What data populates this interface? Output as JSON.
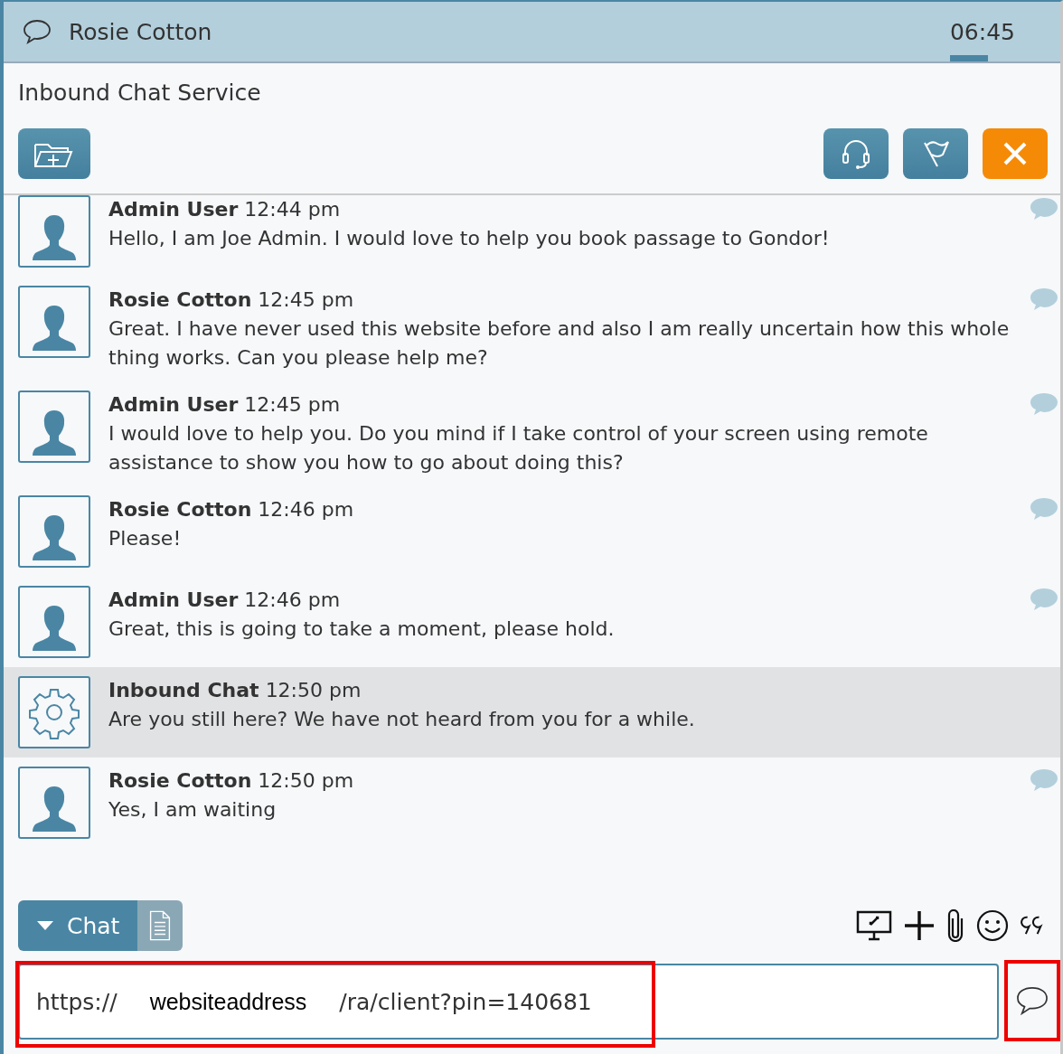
{
  "header": {
    "title": "Rosie Cotton",
    "timer": "06:45"
  },
  "service": "Inbound Chat Service",
  "messages": [
    {
      "kind": "user",
      "sender": "Admin User",
      "time": "12:44 pm",
      "text": "Hello, I am Joe Admin. I would love to help you book passage to Gondor!"
    },
    {
      "kind": "user",
      "sender": "Rosie Cotton",
      "time": "12:45 pm",
      "text": "Great. I have never used this website before and also I am really uncertain how this whole thing works. Can you please help me?"
    },
    {
      "kind": "user",
      "sender": "Admin User",
      "time": "12:45 pm",
      "text": "I would love to help you. Do you mind if I take control of your screen using remote assistance to show you how to go about doing this?"
    },
    {
      "kind": "user",
      "sender": "Rosie Cotton",
      "time": "12:46 pm",
      "text": "Please!"
    },
    {
      "kind": "user",
      "sender": "Admin User",
      "time": "12:46 pm",
      "text": "Great, this is going to take a moment, please hold."
    },
    {
      "kind": "system",
      "sender": "Inbound Chat",
      "time": "12:50 pm",
      "text": "Are you still here? We have not heard from you for a while."
    },
    {
      "kind": "user",
      "sender": "Rosie Cotton",
      "time": "12:50 pm",
      "text": "Yes, I am waiting"
    }
  ],
  "tabs": [
    {
      "kind": "chat",
      "label": "Chat",
      "selected": true
    },
    {
      "kind": "notes",
      "selected": false
    }
  ],
  "input": {
    "value_parts": [
      {
        "kind": "plain",
        "text": "https://"
      },
      {
        "kind": "redacted",
        "text": "websiteaddress"
      },
      {
        "kind": "plain",
        "text": "/ra/client?pin=140681"
      }
    ],
    "highlighted": true
  },
  "send": {
    "highlighted": true
  }
}
